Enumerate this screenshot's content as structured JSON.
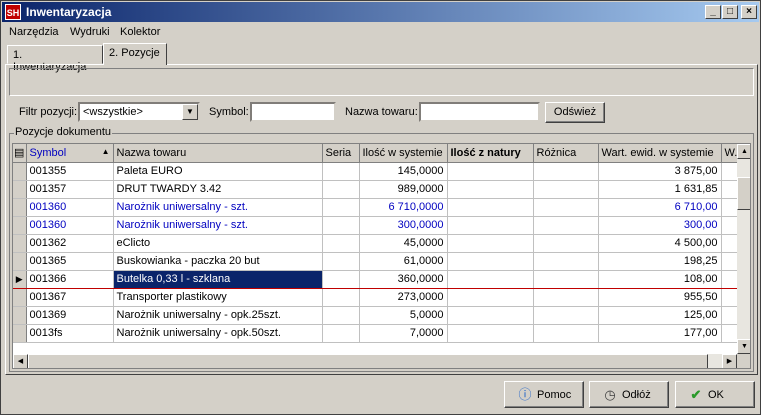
{
  "window": {
    "app_icon": "SH",
    "title": "Inwentaryzacja"
  },
  "title_buttons": {
    "minimize": "_",
    "maximize": "□",
    "close": "×"
  },
  "menu": [
    "Narzędzia",
    "Wydruki",
    "Kolektor"
  ],
  "tabs": [
    "1. Inwentaryzacja",
    "2. Pozycje"
  ],
  "active_tab_index": 1,
  "filter": {
    "filter_label": "Filtr pozycji:",
    "filter_value": "<wszystkie>",
    "symbol_label": "Symbol:",
    "symbol_value": "",
    "name_label": "Nazwa towaru:",
    "name_value": "",
    "refresh_label": "Odśwież"
  },
  "group_label": "Pozycje dokumentu",
  "table": {
    "columns": [
      "Symbol",
      "Nazwa towaru",
      "Seria",
      "Ilość w systemie",
      "Ilość z natury",
      "Różnica",
      "Wart. ewid. w systemie",
      "W..."
    ],
    "rows": [
      {
        "symbol": "001355",
        "name": "Paleta EURO",
        "seria": "",
        "ilosc_sys": "145,0000",
        "ilosc_nat": "",
        "roznica": "",
        "wart": "3 875,00",
        "blue": false,
        "selected": false
      },
      {
        "symbol": "001357",
        "name": "DRUT TWARDY 3.42",
        "seria": "",
        "ilosc_sys": "989,0000",
        "ilosc_nat": "",
        "roznica": "",
        "wart": "1 631,85",
        "blue": false,
        "selected": false
      },
      {
        "symbol": "001360",
        "name": "Narożnik uniwersalny - szt.",
        "seria": "",
        "ilosc_sys": "6 710,0000",
        "ilosc_nat": "",
        "roznica": "",
        "wart": "6 710,00",
        "blue": true,
        "selected": false
      },
      {
        "symbol": "001360",
        "name": "Narożnik uniwersalny - szt.",
        "seria": "",
        "ilosc_sys": "300,0000",
        "ilosc_nat": "",
        "roznica": "",
        "wart": "300,00",
        "blue": true,
        "selected": false
      },
      {
        "symbol": "001362",
        "name": "eClicto",
        "seria": "",
        "ilosc_sys": "45,0000",
        "ilosc_nat": "",
        "roznica": "",
        "wart": "4 500,00",
        "blue": false,
        "selected": false
      },
      {
        "symbol": "001365",
        "name": "Buskowianka - paczka 20 but",
        "seria": "",
        "ilosc_sys": "61,0000",
        "ilosc_nat": "",
        "roznica": "",
        "wart": "198,25",
        "blue": false,
        "selected": false
      },
      {
        "symbol": "001366",
        "name": "Butelka 0,33 l - szklana",
        "seria": "",
        "ilosc_sys": "360,0000",
        "ilosc_nat": "",
        "roznica": "",
        "wart": "108,00",
        "blue": false,
        "selected": true
      },
      {
        "symbol": "001367",
        "name": "Transporter plastikowy",
        "seria": "",
        "ilosc_sys": "273,0000",
        "ilosc_nat": "",
        "roznica": "",
        "wart": "955,50",
        "blue": false,
        "selected": false
      },
      {
        "symbol": "001369",
        "name": "Narożnik uniwersalny - opk.25szt.",
        "seria": "",
        "ilosc_sys": "5,0000",
        "ilosc_nat": "",
        "roznica": "",
        "wart": "125,00",
        "blue": false,
        "selected": false
      },
      {
        "symbol": "0013fs",
        "name": "Narożnik uniwersalny - opk.50szt.",
        "seria": "",
        "ilosc_sys": "7,0000",
        "ilosc_nat": "",
        "roznica": "",
        "wart": "177,00",
        "blue": false,
        "selected": false
      }
    ]
  },
  "buttons": {
    "help": "Pomoc",
    "revert": "Odłóż",
    "ok": "OK"
  },
  "colors": {
    "title_start": "#0a246a",
    "title_end": "#a6caf0",
    "blue_row": "#0000c0",
    "selection": "#0a246a",
    "selected_border": "#c00000"
  },
  "icons": {
    "help": "info-icon",
    "revert": "undo-clock-icon",
    "ok": "checkmark-icon",
    "sort": "sort-ascending-icon",
    "row_pointer": "row-pointer-icon"
  }
}
